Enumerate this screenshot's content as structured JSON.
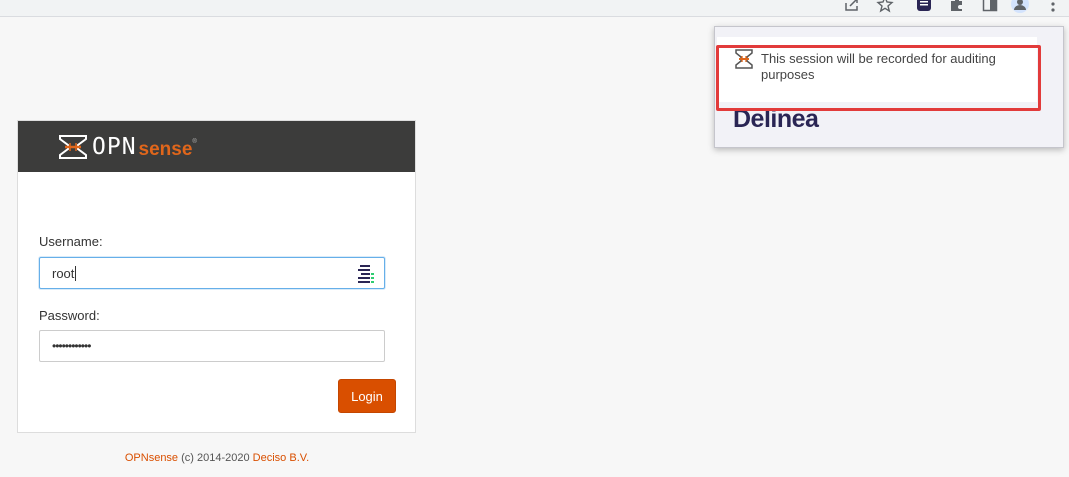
{
  "login": {
    "logo_opn": "OPN",
    "logo_sense": "sense",
    "logo_reg": "®",
    "username_label": "Username:",
    "username_value": "root",
    "password_label": "Password:",
    "password_value": "••••••••••••",
    "login_button": "Login"
  },
  "footer": {
    "brand": "OPNsense",
    "copyright": " (c) 2014-2020 ",
    "company": "Deciso B.V."
  },
  "popup": {
    "message": "This session will be recorded for auditing purposes",
    "brand": "Delinea"
  },
  "colors": {
    "accent": "#d94f00",
    "header_bg": "#3c3c3b",
    "highlight": "#e23b3b",
    "delinea": "#2a2554"
  }
}
